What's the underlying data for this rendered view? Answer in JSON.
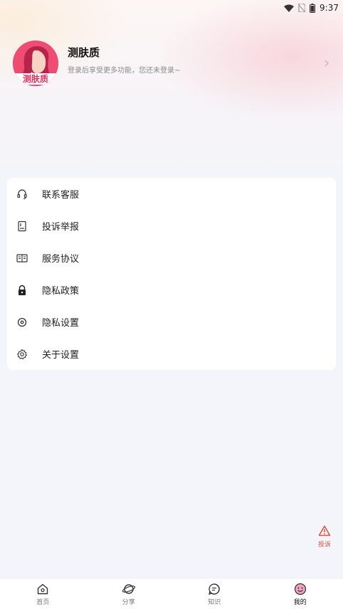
{
  "status_bar": {
    "time": "9:37"
  },
  "profile": {
    "app_name": "测肤质",
    "subtitle": "登录后享受更多功能，您还未登录~",
    "avatar_logo_text": "测肤质"
  },
  "menu": {
    "items": [
      {
        "label": "联系客服",
        "icon": "headset-icon"
      },
      {
        "label": "投诉举报",
        "icon": "report-icon"
      },
      {
        "label": "服务协议",
        "icon": "book-icon"
      },
      {
        "label": "隐私政策",
        "icon": "lock-icon"
      },
      {
        "label": "隐私设置",
        "icon": "privacy-settings-icon"
      },
      {
        "label": "关于设置",
        "icon": "gear-icon"
      }
    ]
  },
  "complaint_button": {
    "label": "投诉",
    "color": "#e84a3c"
  },
  "tabs": [
    {
      "label": "首页",
      "icon": "home-icon",
      "active": false
    },
    {
      "label": "分享",
      "icon": "planet-icon",
      "active": false
    },
    {
      "label": "知识",
      "icon": "chat-icon",
      "active": false
    },
    {
      "label": "我的",
      "icon": "smiley-icon",
      "active": true
    }
  ],
  "colors": {
    "accent": "#e0325e",
    "complaint": "#e84a3c"
  }
}
